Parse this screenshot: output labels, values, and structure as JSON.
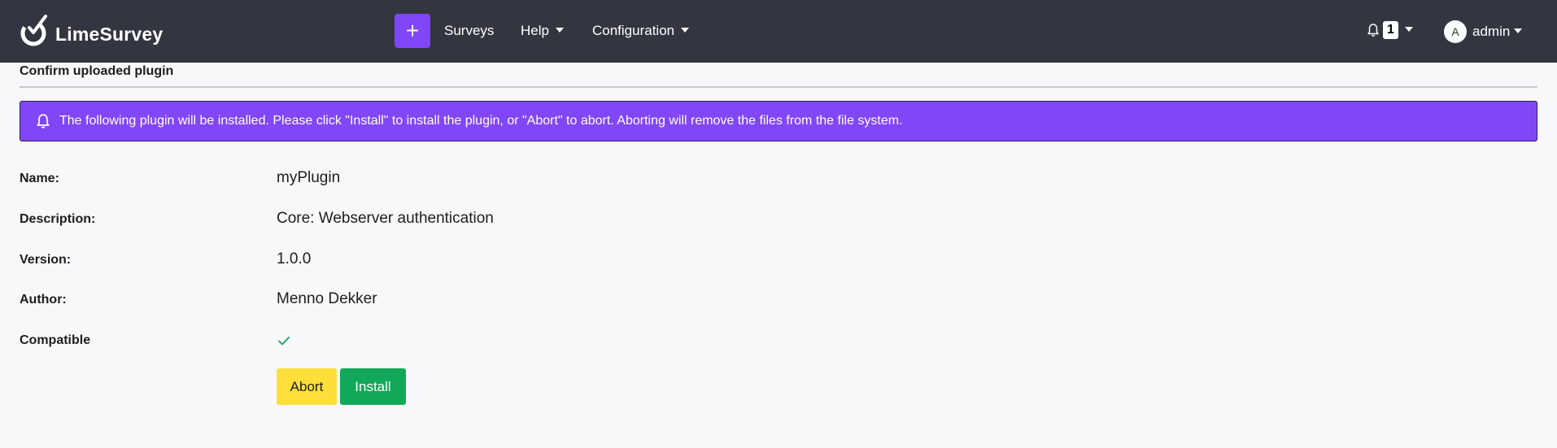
{
  "header": {
    "brand": "LimeSurvey",
    "create_label": "+",
    "nav": [
      {
        "label": "Surveys"
      },
      {
        "label": "Help"
      },
      {
        "label": "Configuration"
      }
    ],
    "notification_count": "1",
    "user": {
      "avatar_letter": "A",
      "name": "admin"
    }
  },
  "page": {
    "title": "Confirm uploaded plugin",
    "alert_message": "The following plugin will be installed. Please click \"Install\" to install the plugin, or \"Abort\" to abort. Aborting will remove the files from the file system."
  },
  "plugin": {
    "fields": [
      {
        "label": "Name:",
        "value": "myPlugin"
      },
      {
        "label": "Description:",
        "value": "Core: Webserver authentication"
      },
      {
        "label": "Version:",
        "value": "1.0.0"
      },
      {
        "label": "Author:",
        "value": "Menno Dekker"
      },
      {
        "label": "Compatible",
        "value": ""
      }
    ],
    "compatible": true
  },
  "actions": {
    "abort_label": "Abort",
    "install_label": "Install"
  },
  "colors": {
    "navbar": "#333641",
    "accent": "#8146f6",
    "abort": "#fedf3a",
    "install": "#12a85a",
    "check": "#12a85a"
  }
}
